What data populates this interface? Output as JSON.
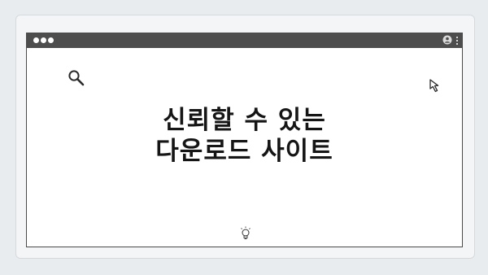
{
  "headline": {
    "line1": "신뢰할 수 있는",
    "line2": "다운로드 사이트"
  },
  "icons": {
    "search": "search-icon",
    "cursor": "cursor-icon",
    "bulb": "lightbulb-icon",
    "user": "user-icon",
    "menu": "more-vertical-icon"
  },
  "colors": {
    "background": "#e9ecef",
    "browser_bar": "#4d4d4d",
    "text": "#151515"
  }
}
